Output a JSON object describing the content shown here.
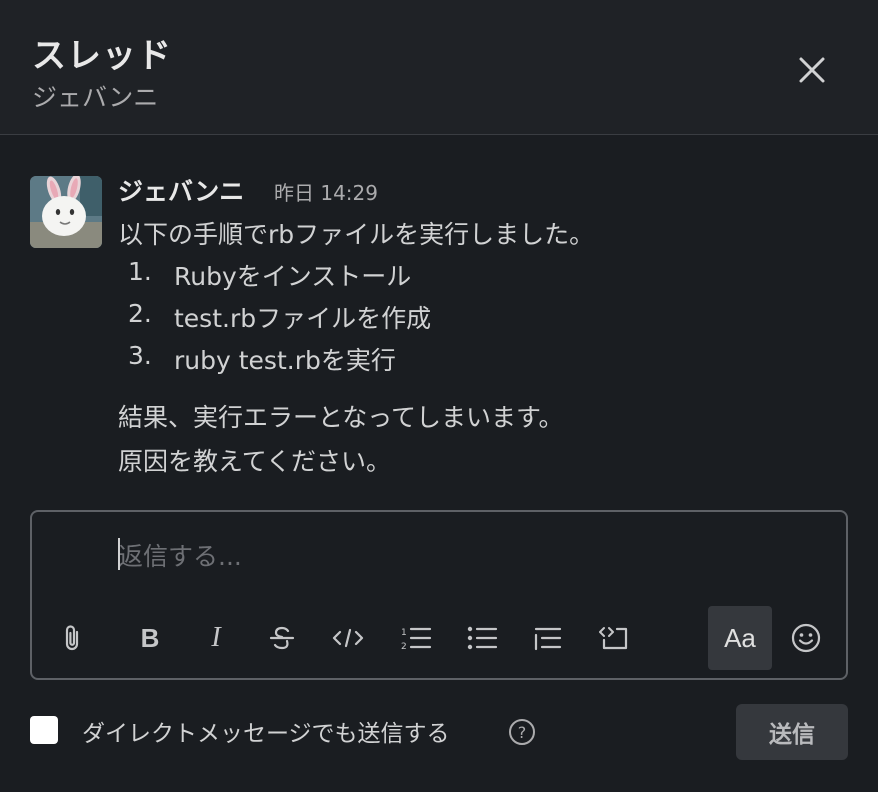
{
  "header": {
    "title": "スレッド",
    "subtitle": "ジェバンニ",
    "close_icon": "close-icon"
  },
  "message": {
    "author": "ジェバンニ",
    "timestamp": "昨日 14:29",
    "intro": "以下の手順でrbファイルを実行しました。",
    "steps": [
      {
        "num": "1.",
        "text": "Rubyをインストール"
      },
      {
        "num": "2.",
        "text": "test.rbファイルを作成"
      },
      {
        "num": "3.",
        "text": "ruby test.rbを実行"
      }
    ],
    "result_line1": "結果、実行エラーとなってしまいます。",
    "result_line2": "原因を教えてください。"
  },
  "composer": {
    "placeholder": "返信する...",
    "value": "",
    "format_label": "Aa",
    "tools": [
      "attach-icon",
      "bold-icon",
      "italic-icon",
      "strikethrough-icon",
      "code-icon",
      "ordered-list-icon",
      "bulleted-list-icon",
      "blockquote-icon",
      "code-block-icon",
      "emoji-icon"
    ]
  },
  "footer": {
    "also_send_label": "ダイレクトメッセージでも送信する",
    "also_send_checked": false,
    "send_label": "送信"
  },
  "colors": {
    "background": "#1a1d21",
    "header_bg": "#1f2226",
    "text": "#d1d2d3",
    "muted": "#ababad",
    "button_bg": "#35383d"
  }
}
